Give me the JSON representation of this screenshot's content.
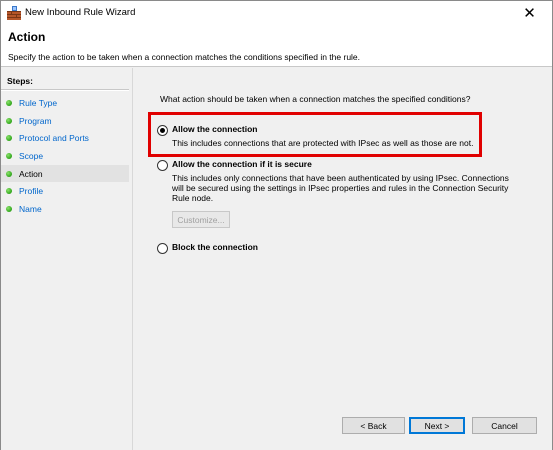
{
  "window": {
    "title": "New Inbound Rule Wizard",
    "close_glyph": "✕"
  },
  "header": {
    "title": "Action",
    "description": "Specify the action to be taken when a connection matches the conditions specified in the rule."
  },
  "sidebar": {
    "steps_label": "Steps:",
    "items": [
      {
        "label": "Rule Type",
        "current": false
      },
      {
        "label": "Program",
        "current": false
      },
      {
        "label": "Protocol and Ports",
        "current": false
      },
      {
        "label": "Scope",
        "current": false
      },
      {
        "label": "Action",
        "current": true
      },
      {
        "label": "Profile",
        "current": false
      },
      {
        "label": "Name",
        "current": false
      }
    ]
  },
  "main": {
    "question": "What action should be taken when a connection matches the specified conditions?",
    "options": [
      {
        "title": "Allow the connection",
        "description": "This includes connections that are protected with IPsec as well as those are not.",
        "selected": true
      },
      {
        "title": "Allow the connection if it is secure",
        "description": "This includes only connections that have been authenticated by using IPsec.  Connections will be secured using the settings in IPsec properties and rules in the Connection Security Rule node.",
        "selected": false
      },
      {
        "title": "Block the connection",
        "description": "",
        "selected": false
      }
    ],
    "customize_label": "Customize..."
  },
  "footer": {
    "back_label": "< Back",
    "next_label": "Next >",
    "cancel_label": "Cancel"
  },
  "colors": {
    "highlight": "#e00000",
    "link": "#0066cc",
    "step_dot": "#2fa51a"
  }
}
